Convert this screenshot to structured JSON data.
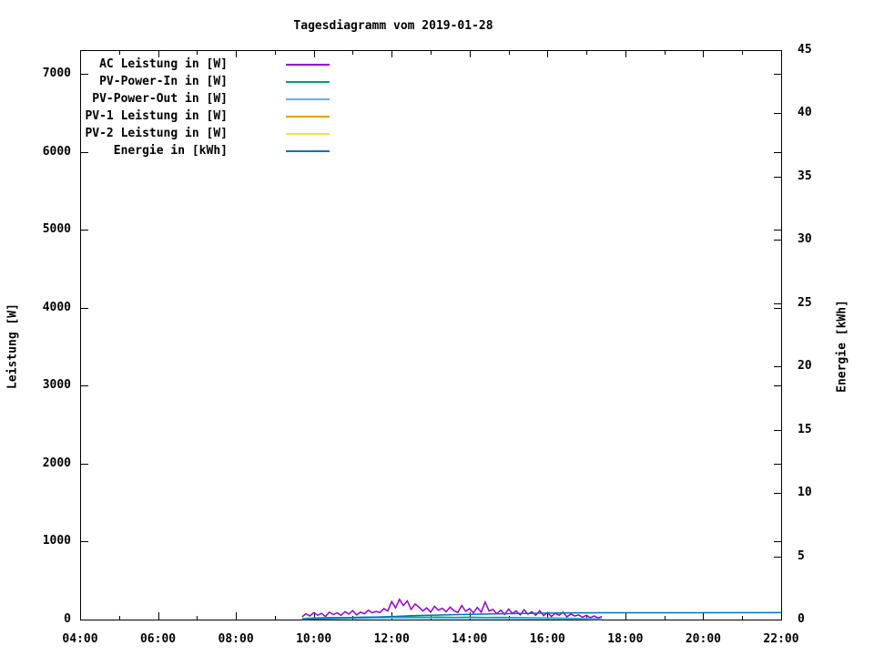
{
  "chart_data": {
    "type": "line",
    "title": "Tagesdiagramm vom 2019-01-28",
    "xlabel": "",
    "ylabel": "Leistung [W]",
    "y2label": "Energie [kWh]",
    "xlim_hours": [
      4,
      22
    ],
    "ylim": [
      0,
      7000
    ],
    "y2lim": [
      0,
      45
    ],
    "grid": false,
    "legend_position": "top-left-inside",
    "x_tick_labels": [
      "04:00",
      "06:00",
      "08:00",
      "10:00",
      "12:00",
      "14:00",
      "16:00",
      "18:00",
      "20:00",
      "22:00"
    ],
    "x_tick_hours": [
      4,
      6,
      8,
      10,
      12,
      14,
      16,
      18,
      20,
      22
    ],
    "x_minor_tick_hours": [
      5,
      7,
      9,
      11,
      13,
      15,
      17,
      19,
      21
    ],
    "y_ticks": [
      0,
      1000,
      2000,
      3000,
      4000,
      5000,
      6000,
      7000
    ],
    "y2_ticks": [
      0,
      5,
      10,
      15,
      20,
      25,
      30,
      35,
      40,
      45
    ],
    "series": [
      {
        "name": "AC Leistung in [W]",
        "color": "#9400d3",
        "axis": "y1",
        "points": [
          [
            9.7,
            35
          ],
          [
            9.8,
            75
          ],
          [
            9.9,
            45
          ],
          [
            10.0,
            90
          ],
          [
            10.1,
            55
          ],
          [
            10.2,
            80
          ],
          [
            10.3,
            40
          ],
          [
            10.4,
            95
          ],
          [
            10.5,
            65
          ],
          [
            10.6,
            85
          ],
          [
            10.7,
            55
          ],
          [
            10.8,
            100
          ],
          [
            10.9,
            70
          ],
          [
            11.0,
            115
          ],
          [
            11.1,
            60
          ],
          [
            11.2,
            95
          ],
          [
            11.3,
            75
          ],
          [
            11.4,
            120
          ],
          [
            11.5,
            85
          ],
          [
            11.6,
            105
          ],
          [
            11.7,
            90
          ],
          [
            11.8,
            140
          ],
          [
            11.9,
            110
          ],
          [
            12.0,
            230
          ],
          [
            12.1,
            150
          ],
          [
            12.2,
            260
          ],
          [
            12.3,
            180
          ],
          [
            12.4,
            240
          ],
          [
            12.5,
            130
          ],
          [
            12.6,
            200
          ],
          [
            12.7,
            160
          ],
          [
            12.8,
            110
          ],
          [
            12.9,
            150
          ],
          [
            13.0,
            95
          ],
          [
            13.1,
            170
          ],
          [
            13.2,
            120
          ],
          [
            13.3,
            145
          ],
          [
            13.4,
            100
          ],
          [
            13.5,
            160
          ],
          [
            13.6,
            115
          ],
          [
            13.7,
            90
          ],
          [
            13.8,
            180
          ],
          [
            13.9,
            105
          ],
          [
            14.0,
            140
          ],
          [
            14.1,
            85
          ],
          [
            14.2,
            155
          ],
          [
            14.3,
            95
          ],
          [
            14.4,
            225
          ],
          [
            14.5,
            110
          ],
          [
            14.6,
            130
          ],
          [
            14.7,
            75
          ],
          [
            14.8,
            120
          ],
          [
            14.9,
            65
          ],
          [
            15.0,
            135
          ],
          [
            15.1,
            80
          ],
          [
            15.2,
            110
          ],
          [
            15.3,
            60
          ],
          [
            15.4,
            125
          ],
          [
            15.5,
            70
          ],
          [
            15.6,
            100
          ],
          [
            15.7,
            55
          ],
          [
            15.8,
            115
          ],
          [
            15.9,
            50
          ],
          [
            16.0,
            90
          ],
          [
            16.1,
            40
          ],
          [
            16.2,
            80
          ],
          [
            16.3,
            55
          ],
          [
            16.4,
            95
          ],
          [
            16.5,
            35
          ],
          [
            16.6,
            70
          ],
          [
            16.7,
            45
          ],
          [
            16.8,
            60
          ],
          [
            16.9,
            30
          ],
          [
            17.0,
            55
          ],
          [
            17.1,
            25
          ],
          [
            17.2,
            45
          ],
          [
            17.3,
            20
          ],
          [
            17.4,
            40
          ]
        ]
      },
      {
        "name": "PV-Power-In in [W]",
        "color": "#009e73",
        "axis": "y1",
        "points": [
          [
            9.7,
            12
          ],
          [
            10.0,
            20
          ],
          [
            10.4,
            26
          ],
          [
            10.8,
            24
          ],
          [
            11.2,
            30
          ],
          [
            11.6,
            33
          ],
          [
            12.0,
            35
          ],
          [
            12.4,
            32
          ],
          [
            12.8,
            30
          ],
          [
            13.2,
            33
          ],
          [
            13.6,
            28
          ],
          [
            14.0,
            30
          ],
          [
            14.4,
            26
          ],
          [
            14.8,
            28
          ],
          [
            15.2,
            24
          ],
          [
            15.6,
            22
          ],
          [
            16.0,
            20
          ],
          [
            16.4,
            17
          ],
          [
            16.8,
            14
          ],
          [
            17.2,
            11
          ],
          [
            17.4,
            9
          ]
        ]
      },
      {
        "name": "PV-Power-Out in [W]",
        "axis": "y1",
        "color": "#56b4e9",
        "points": [
          [
            9.7,
            6
          ],
          [
            10.2,
            12
          ],
          [
            10.8,
            15
          ],
          [
            11.4,
            18
          ],
          [
            12.0,
            20
          ],
          [
            12.6,
            19
          ],
          [
            13.2,
            18
          ],
          [
            13.8,
            17
          ],
          [
            14.4,
            16
          ],
          [
            15.0,
            14
          ],
          [
            15.6,
            12
          ],
          [
            16.2,
            10
          ],
          [
            16.8,
            8
          ],
          [
            17.4,
            5
          ]
        ]
      },
      {
        "name": "PV-1 Leistung in [W]",
        "color": "#e69f00",
        "axis": "y1",
        "points": []
      },
      {
        "name": "PV-2 Leistung in [W]",
        "color": "#f0e442",
        "axis": "y1",
        "points": []
      },
      {
        "name": "Energie in [kWh]",
        "color": "#0072b2",
        "axis": "y2",
        "points": [
          [
            9.7,
            0.02
          ],
          [
            10.0,
            0.05
          ],
          [
            10.5,
            0.1
          ],
          [
            11.0,
            0.14
          ],
          [
            11.5,
            0.19
          ],
          [
            12.0,
            0.24
          ],
          [
            12.5,
            0.3
          ],
          [
            13.0,
            0.34
          ],
          [
            13.5,
            0.38
          ],
          [
            14.0,
            0.41
          ],
          [
            14.5,
            0.44
          ],
          [
            15.0,
            0.47
          ],
          [
            15.5,
            0.49
          ],
          [
            16.0,
            0.51
          ],
          [
            16.5,
            0.52
          ],
          [
            17.0,
            0.53
          ],
          [
            17.4,
            0.54
          ],
          [
            22.0,
            0.55
          ]
        ]
      }
    ]
  }
}
